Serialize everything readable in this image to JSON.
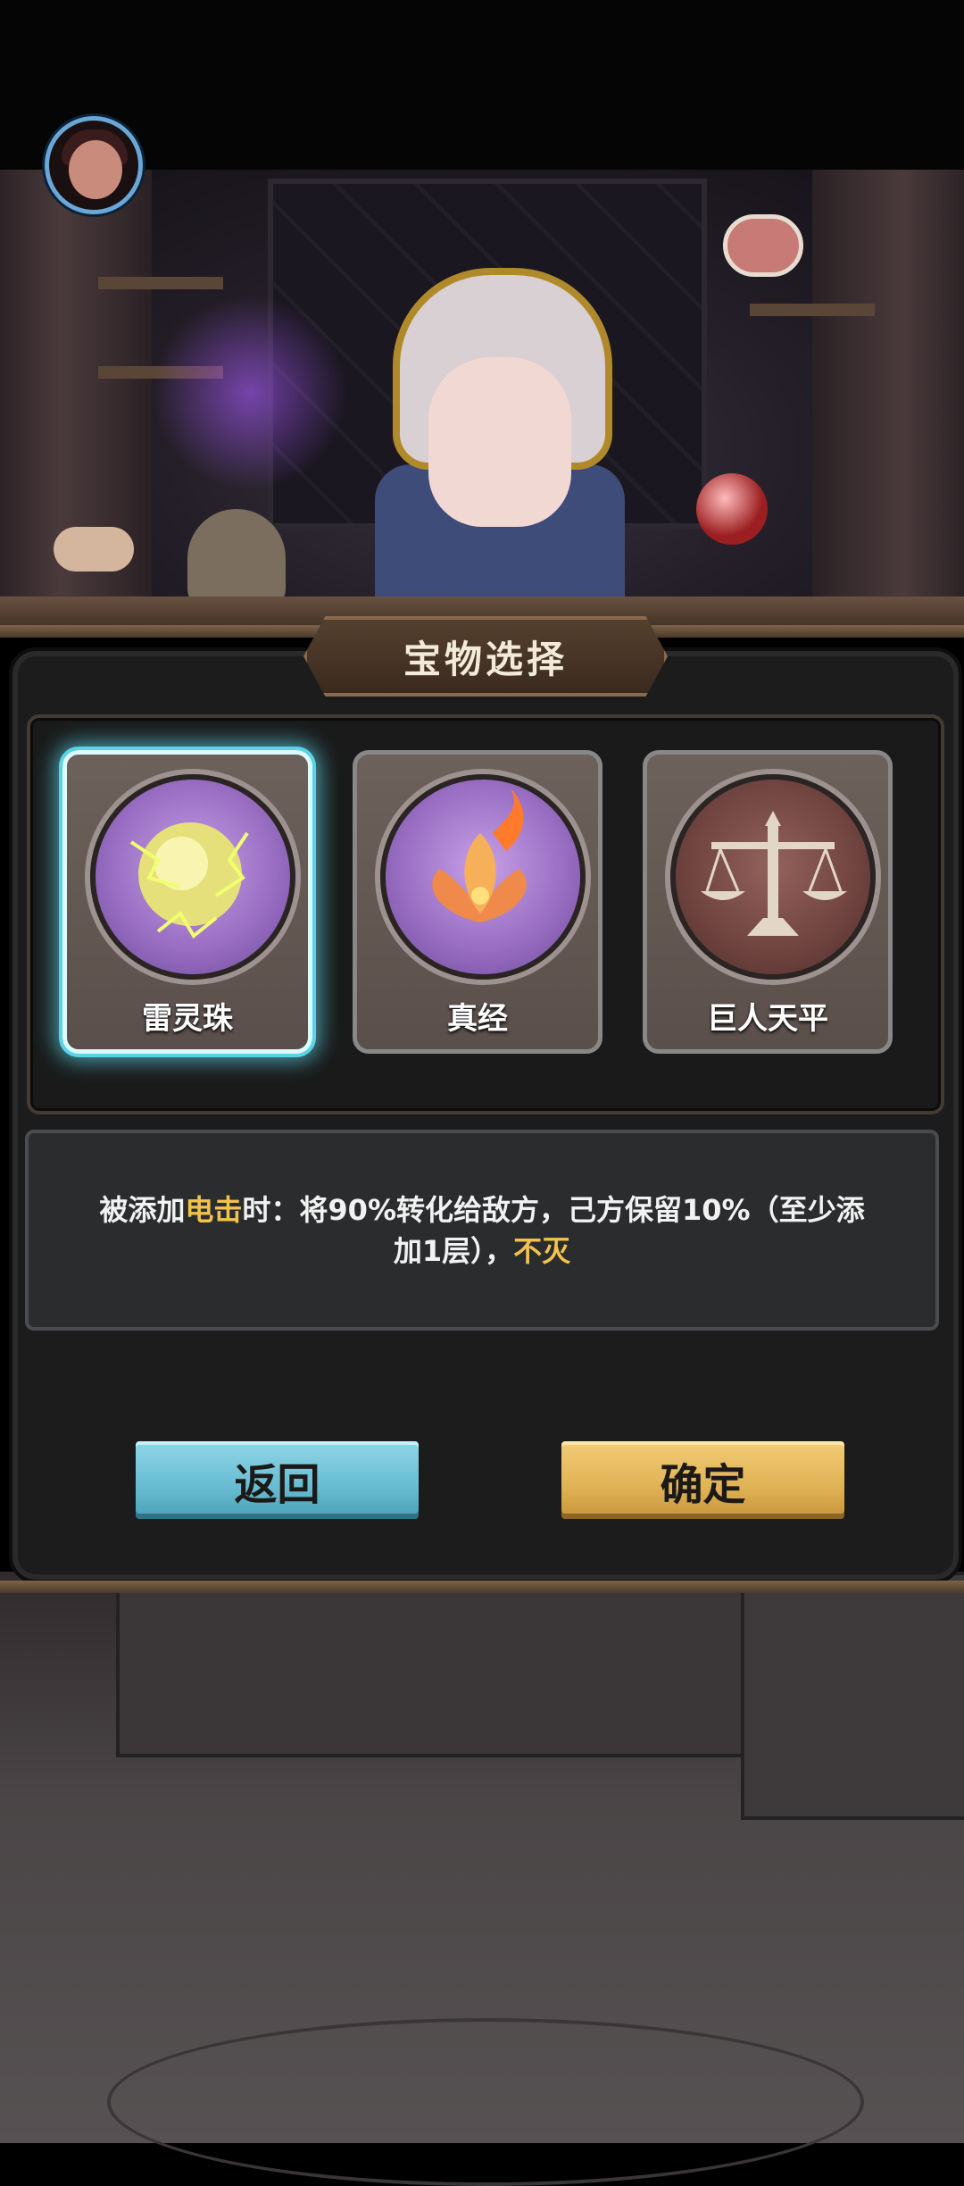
{
  "header": {
    "title": "宝物选择"
  },
  "items": [
    {
      "name": "雷灵珠",
      "icon": "lightning-orb-icon",
      "selected": true
    },
    {
      "name": "真经",
      "icon": "flame-lotus-icon",
      "selected": false
    },
    {
      "name": "巨人天平",
      "icon": "balance-scale-icon",
      "selected": false
    }
  ],
  "description": {
    "part1": "被添加",
    "highlight1": "电击",
    "part2": "时：将90%转化给敌方，己方保留10%（至少添加1层），",
    "highlight2": "不灭"
  },
  "buttons": {
    "back_label": "返回",
    "confirm_label": "确定"
  },
  "colors": {
    "highlight": "#f1c24e",
    "selected_glow": "#58d4e6",
    "back_button": "#67bcd2",
    "confirm_button": "#e0b255"
  }
}
